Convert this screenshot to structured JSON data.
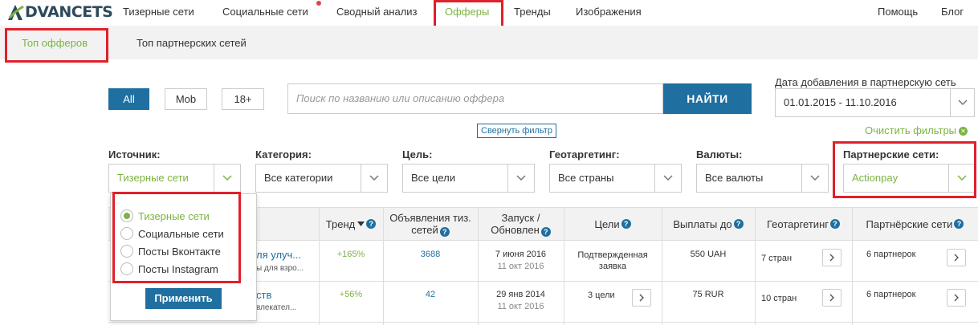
{
  "brand": {
    "logo_text": "DVANCETS"
  },
  "nav": {
    "items": [
      "Тизерные сети",
      "Социальные сети",
      "Сводный анализ",
      "Офферы",
      "Тренды",
      "Изображения"
    ],
    "right": [
      "Помощь",
      "Блог"
    ]
  },
  "subnav": {
    "items": [
      "Топ офферов",
      "Топ партнерских сетей"
    ]
  },
  "filters": {
    "device_buttons": [
      "All",
      "Mob",
      "18+"
    ],
    "search_placeholder": "Поиск по названию или описанию оффера",
    "search_button": "НАЙТИ",
    "date_label": "Дата добавления в партнерскую сеть",
    "date_value": "01.01.2015 - 11.10.2016",
    "collapse_label": "Свернуть фильтр",
    "clear_label": "Очистить фильтры",
    "groups": [
      {
        "label": "Источник:",
        "value": "Тизерные сети"
      },
      {
        "label": "Категория:",
        "value": "Все категории"
      },
      {
        "label": "Цель:",
        "value": "Все цели"
      },
      {
        "label": "Геотаргетинг:",
        "value": "Все страны"
      },
      {
        "label": "Валюты:",
        "value": "Все валюты"
      },
      {
        "label": "Партнерские сети:",
        "value": "Actionpay"
      }
    ]
  },
  "source_dropdown": {
    "options": [
      "Тизерные сети",
      "Социальные сети",
      "Посты Вконтакте",
      "Посты Instagram"
    ],
    "selected": "Тизерные сети",
    "apply_label": "Применить"
  },
  "table": {
    "headers": {
      "trend": "Тренд",
      "ads": "Объявления тиз. сетей",
      "launch": "Запуск / Обновлен",
      "goals": "Цели",
      "payout": "Выплаты до",
      "geo": "Геотаргетинг",
      "networks": "Партнёрские сети"
    },
    "rows": [
      {
        "title": "ля улуч...",
        "subtitle": "ы для взро...",
        "trend": "+165%",
        "ads": "3688",
        "launch": "7 июня 2016",
        "updated": "11 окт 2016",
        "goals": "Подтвержденная заявка",
        "payout": "550 UAH",
        "geo": "7 стран",
        "networks": "6 партнерок"
      },
      {
        "title": "ств",
        "subtitle": "влекател...",
        "trend": "+56%",
        "ads": "42",
        "launch": "29 янв 2014",
        "updated": "11 окт 2016",
        "goals": "3 цели",
        "payout": "75 RUR",
        "geo": "10 стран",
        "networks": "6 партнерок"
      }
    ]
  },
  "colors": {
    "accent_green": "#7cb342",
    "primary_blue": "#1f6fa0",
    "highlight_red": "#e0202a"
  }
}
